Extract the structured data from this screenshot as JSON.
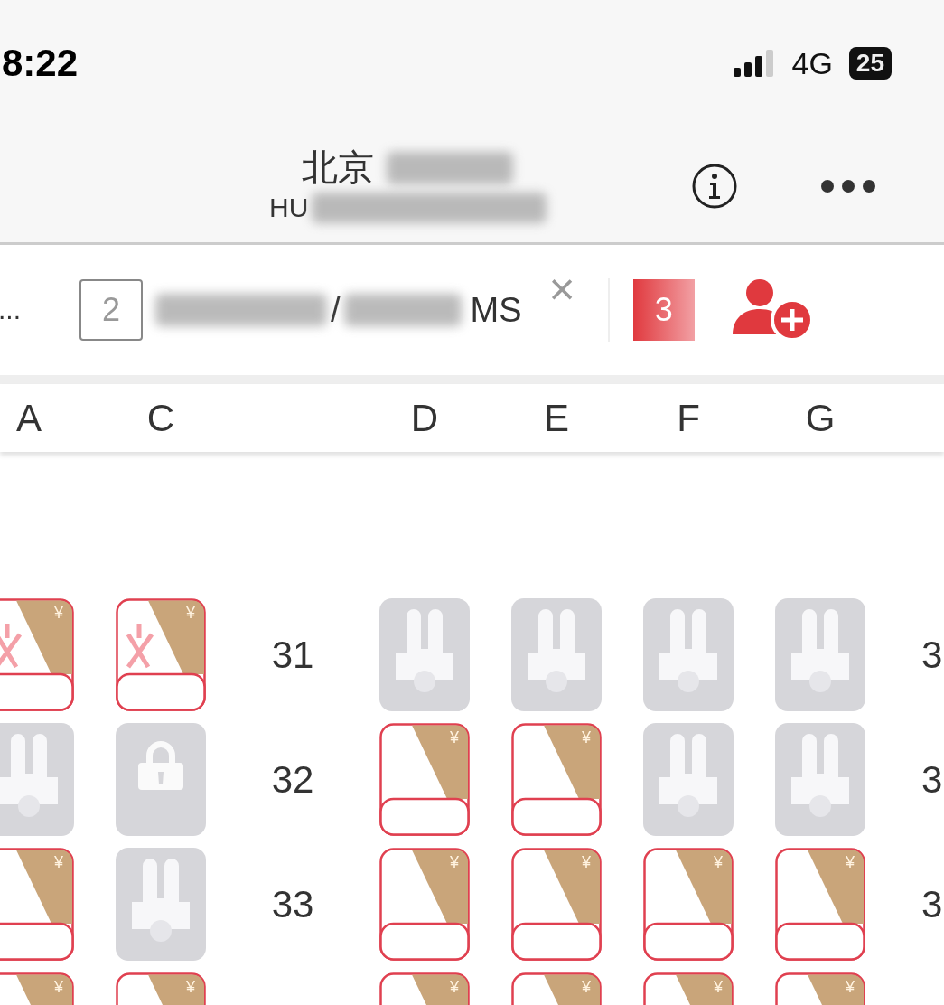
{
  "status_bar": {
    "time": "8:22",
    "network": "4G",
    "battery": "25"
  },
  "header": {
    "title": "北京",
    "subtitle": "HU"
  },
  "passenger_bar": {
    "overflow": "...",
    "passenger_number": "2",
    "separator": "/",
    "title": "MS",
    "close": "×",
    "next_number": "3"
  },
  "left_columns": [
    "A",
    "C"
  ],
  "right_columns": [
    "D",
    "E",
    "F",
    "G"
  ],
  "rows": [
    {
      "number": "31",
      "right_number": "3",
      "left": [
        {
          "kind": "marked",
          "price": "¥"
        },
        {
          "kind": "marked",
          "price": "¥"
        }
      ],
      "right": [
        {
          "kind": "taken"
        },
        {
          "kind": "taken"
        },
        {
          "kind": "taken"
        },
        {
          "kind": "taken"
        }
      ]
    },
    {
      "number": "32",
      "right_number": "3",
      "left": [
        {
          "kind": "taken"
        },
        {
          "kind": "locked"
        }
      ],
      "right": [
        {
          "kind": "paid",
          "price": "¥"
        },
        {
          "kind": "paid",
          "price": "¥"
        },
        {
          "kind": "taken"
        },
        {
          "kind": "taken"
        }
      ]
    },
    {
      "number": "33",
      "right_number": "3",
      "left": [
        {
          "kind": "paid",
          "price": "¥"
        },
        {
          "kind": "taken"
        }
      ],
      "right": [
        {
          "kind": "paid",
          "price": "¥"
        },
        {
          "kind": "paid",
          "price": "¥"
        },
        {
          "kind": "paid",
          "price": "¥"
        },
        {
          "kind": "paid",
          "price": "¥"
        }
      ]
    },
    {
      "left": [
        {
          "kind": "paid",
          "price": "¥"
        },
        {
          "kind": "paid",
          "price": "¥"
        }
      ],
      "right": [
        {
          "kind": "paid",
          "price": "¥"
        },
        {
          "kind": "paid",
          "price": "¥"
        },
        {
          "kind": "paid",
          "price": "¥"
        },
        {
          "kind": "paid",
          "price": "¥"
        }
      ]
    }
  ]
}
